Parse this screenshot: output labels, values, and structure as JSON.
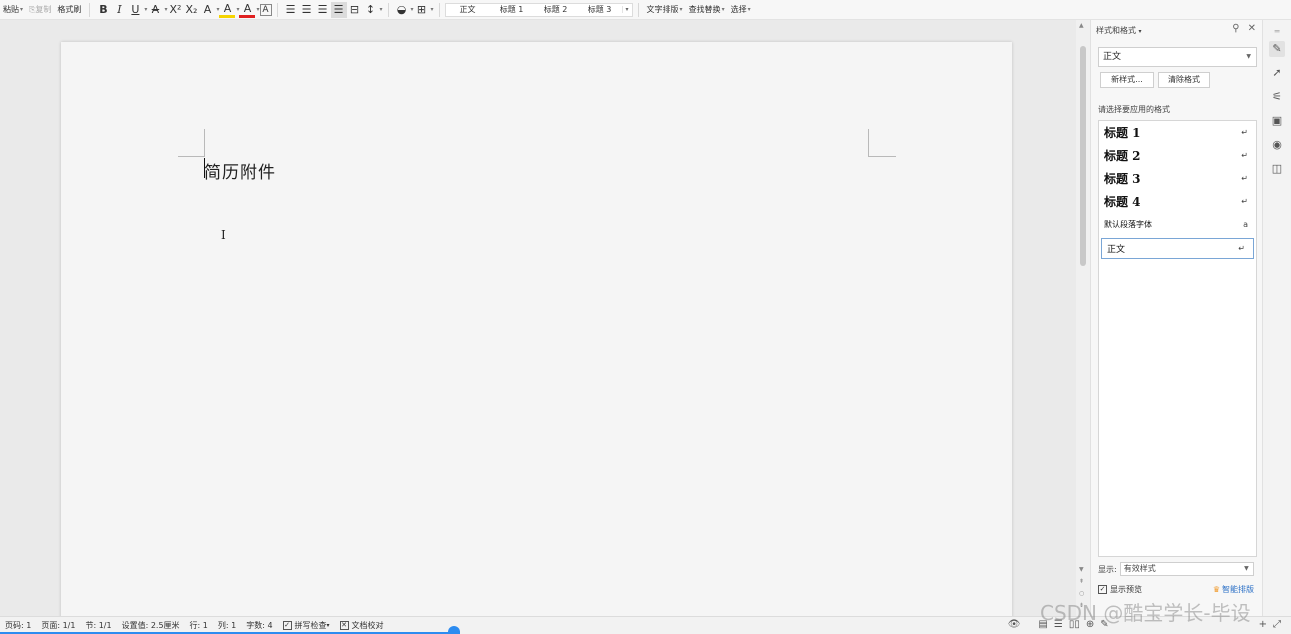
{
  "toolbar": {
    "paste": "粘贴",
    "copy": "复制",
    "format_painter": "格式刷",
    "bold": "B",
    "italic": "I",
    "underline": "U",
    "strike": "A",
    "superscript": "X²",
    "subscript": "X₂",
    "clear_format": "A",
    "highlight": "A",
    "font_color": "A",
    "char_border": "A",
    "styles": [
      "正文",
      "标题 1",
      "标题 2",
      "标题 3"
    ],
    "text_layout": "文字排版",
    "find_replace": "查找替换",
    "select": "选择"
  },
  "document": {
    "text": "简历附件",
    "cursor_glyph": "I"
  },
  "panel": {
    "title": "样式和格式",
    "current_style": "正文",
    "new_style_button": "新样式...",
    "clear_format_button": "清除格式",
    "apply_label": "请选择要应用的格式",
    "styles": [
      {
        "label": "标题  1",
        "kind": "heading",
        "mark": "↵"
      },
      {
        "label": "标题  2",
        "kind": "heading",
        "mark": "↵"
      },
      {
        "label": "标题  3",
        "kind": "heading",
        "mark": "↵"
      },
      {
        "label": "标题  4",
        "kind": "heading",
        "mark": "↵"
      },
      {
        "label": "默认段落字体",
        "kind": "small",
        "mark": "a"
      },
      {
        "label": "正文",
        "kind": "selected",
        "mark": "↵"
      }
    ],
    "show_label": "显示:",
    "show_value": "有效样式",
    "preview_label": "显示预览",
    "smart_layout": "智能排版"
  },
  "status": {
    "page_num": "页码: 1",
    "pages": "页面: 1/1",
    "section": "节: 1/1",
    "position": "设置值: 2.5厘米",
    "row": "行: 1",
    "col": "列: 1",
    "word_count": "字数: 4",
    "spell_check": "拼写检查",
    "doc_check": "文档校对"
  },
  "watermark": "CSDN @酷宝学长-毕设"
}
